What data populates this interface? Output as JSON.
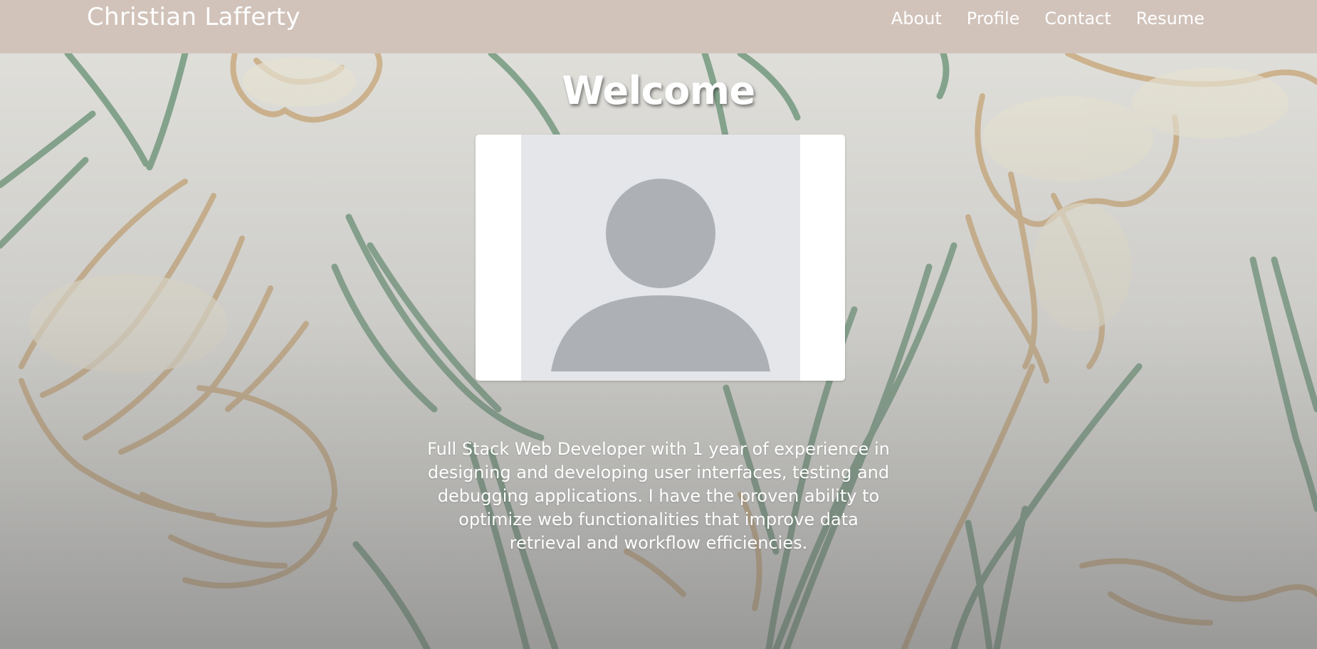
{
  "navbar": {
    "brand": "Christian Lafferty",
    "links": [
      "About",
      "Profile",
      "Contact",
      "Resume"
    ]
  },
  "hero": {
    "heading": "Welcome",
    "avatar_icon": "user-placeholder-icon",
    "bio": "Full Stack Web Developer with 1 year of experience in designing and developing user interfaces, testing and debugging applications. I have the proven ability to optimize web functionalities that improve data retrieval and workflow efficiencies."
  },
  "colors": {
    "navbar_bg": "#d1c3ba",
    "text": "#ffffff",
    "avatar_bg": "#e4e6e9",
    "avatar_fg": "#adb1b5"
  }
}
